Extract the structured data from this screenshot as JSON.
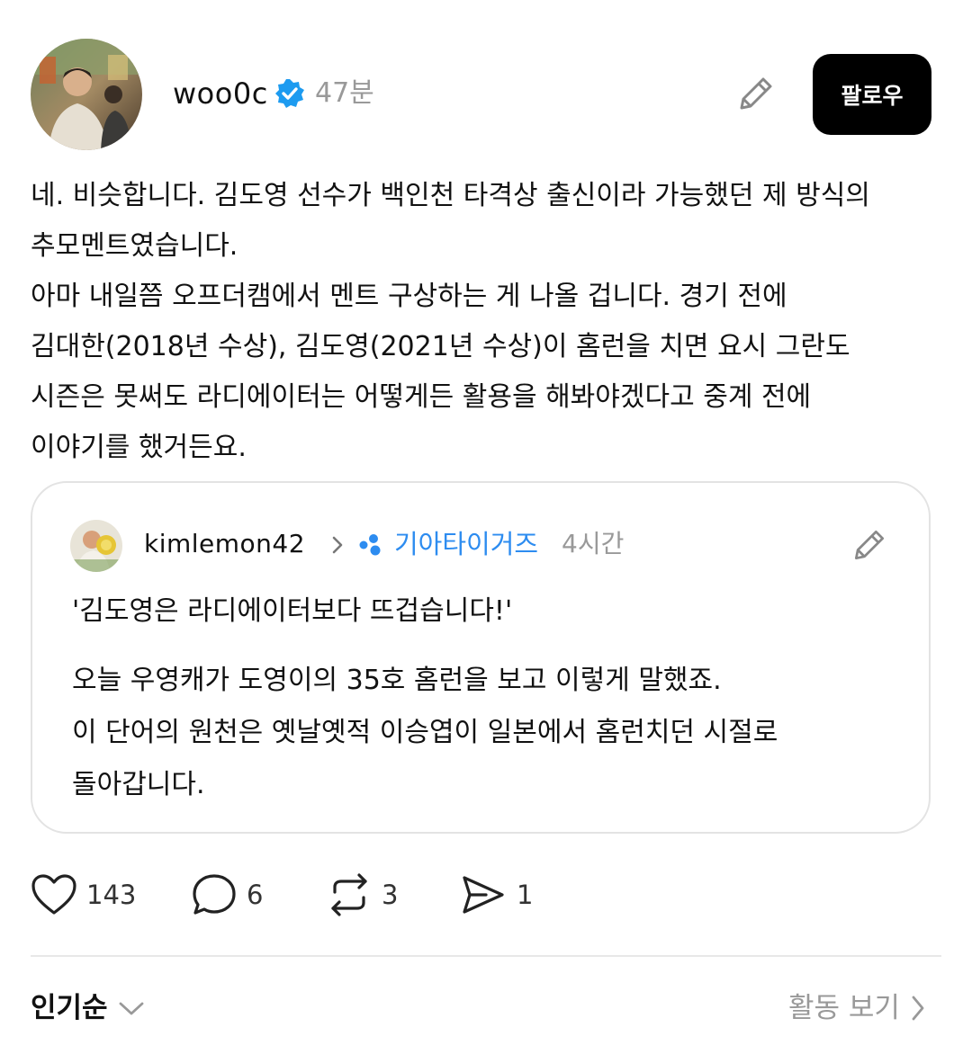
{
  "post": {
    "username": "woo0c",
    "time": "47분",
    "follow_label": "팔로우",
    "text_lines": [
      "네. 비슷합니다. 김도영 선수가 백인천 타격상 출신이라 가능했던 제 방식의",
      "추모멘트였습니다.",
      "아마 내일쯤 오프더캠에서 멘트 구상하는 게 나올 겁니다. 경기 전에",
      "김대한(2018년 수상), 김도영(2021년 수상)이 홈런을 치면 요시 그란도",
      "시즌은 못써도 라디에이터는 어떻게든 활용을 해봐야겠다고 중계 전에",
      "이야기를 했거든요."
    ]
  },
  "quote": {
    "username": "kimlemon42",
    "community": "기아타이거즈",
    "time": "4시간",
    "headline": "'김도영은 라디에이터보다 뜨겁습니다!'",
    "body_lines": [
      "오늘 우영캐가 도영이의 35호 홈런을 보고 이렇게 말했죠.",
      "이 단어의 원천은 옛날옛적 이승엽이 일본에서 홈런치던 시절로",
      "돌아갑니다."
    ]
  },
  "actions": {
    "likes": "143",
    "replies": "6",
    "reposts": "3",
    "shares": "1"
  },
  "footer": {
    "sort_label": "인기순",
    "activity_label": "활동 보기"
  },
  "colors": {
    "verified": "#1d9bf0",
    "community": "#2d8cf0",
    "muted": "#999999",
    "follow_bg": "#000000"
  },
  "icons": [
    "verified-badge-icon",
    "pencil-icon",
    "chevron-right-icon",
    "community-dots-icon",
    "heart-icon",
    "comment-icon",
    "repost-icon",
    "send-icon",
    "chevron-down-icon"
  ]
}
